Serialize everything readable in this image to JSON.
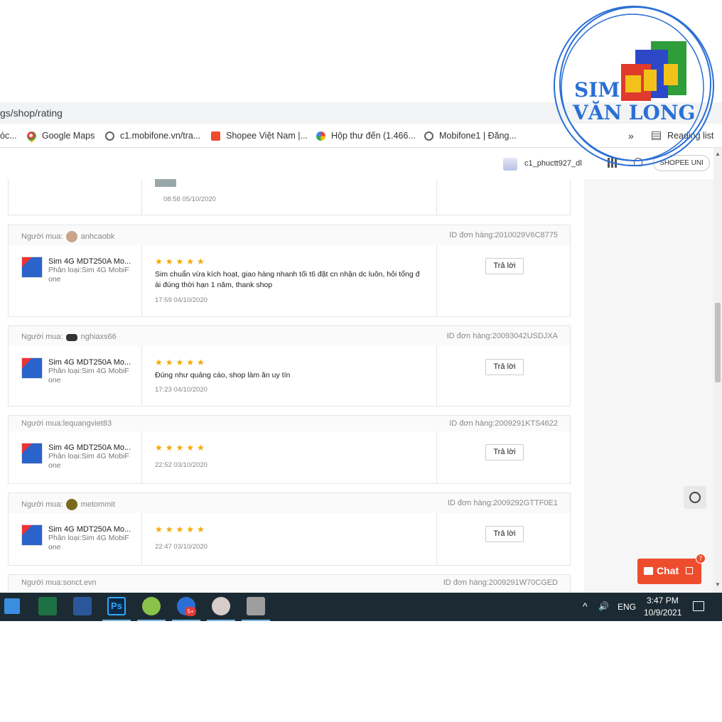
{
  "browser": {
    "url": "gs/shop/rating",
    "bookmarks": [
      {
        "label": "óc...",
        "icon": "bookmark-icon"
      },
      {
        "label": "Google Maps",
        "icon": "maps-pin-icon"
      },
      {
        "label": "c1.mobifone.vn/tra...",
        "icon": "globe-icon"
      },
      {
        "label": "Shopee Việt Nam |...",
        "icon": "shopee-bag-icon"
      },
      {
        "label": "Hộp thư đến (1.466...",
        "icon": "google-g-icon"
      },
      {
        "label": "Mobifone1 | Đăng...",
        "icon": "globe-icon"
      }
    ],
    "more": "»",
    "reading_list": "Reading list"
  },
  "header": {
    "username": "c1_phuctt927_dl",
    "shopee_uni": "SHOPEE UNI"
  },
  "watermark": {
    "line1": "SIM",
    "line2": "VĂN LONG"
  },
  "top_partial": {
    "time": "08:58 05/10/2020"
  },
  "reviews": [
    {
      "buyer_label": "Người mua:",
      "buyer": "anhcaobk",
      "order_id": "ID đơn hàng:2010029V6C8775",
      "product": "Sim 4G MDT250A Mo...",
      "variant": "Phân loại:Sim 4G MobiF one",
      "stars": "★★★★★",
      "rating": 5,
      "comment": "Sim chuẩn vừa kích hoạt, giao hàng nhanh tối t6 đặt cn nhận dc luôn, hỏi tổng đ ài đúng thời hạn 1 năm, thank shop",
      "time": "17:59 04/10/2020",
      "reply": "Trả lời"
    },
    {
      "buyer_label": "Người mua:",
      "buyer": "nghiaxs66",
      "order_id": "ID đơn hàng:20093042USDJXA",
      "product": "Sim 4G MDT250A Mo...",
      "variant": "Phân loại:Sim 4G MobiF one",
      "stars": "★★★★★",
      "rating": 5,
      "comment": "Đúng như quảng cáo, shop làm ăn uy tín",
      "time": "17:23 04/10/2020",
      "reply": "Trả lời"
    },
    {
      "buyer_label": "Người mua:",
      "buyer": "lequangviet83",
      "order_id": "ID đơn hàng:2009291KTS4622",
      "product": "Sim 4G MDT250A Mo...",
      "variant": "Phân loại:Sim 4G MobiF one",
      "stars": "★★★★★",
      "rating": 5,
      "comment": "",
      "time": "22:52 03/10/2020",
      "reply": "Trả lời"
    },
    {
      "buyer_label": "Người mua:",
      "buyer": "metommit",
      "order_id": "ID đơn hàng:2009292GTTF0E1",
      "product": "Sim 4G MDT250A Mo...",
      "variant": "Phân loại:Sim 4G MobiF one",
      "stars": "★★★★★",
      "rating": 5,
      "comment": "",
      "time": "22:47 03/10/2020",
      "reply": "Trả lời"
    },
    {
      "buyer_label": "Người mua:",
      "buyer": "sonct.evn",
      "order_id": "ID đơn hàng:2009291W70CGED"
    }
  ],
  "chat": {
    "label": "Chat",
    "badge": "7"
  },
  "taskbar": {
    "lang": "ENG",
    "time": "3:47 PM",
    "date": "10/9/2021",
    "zalo_badge": "5+",
    "ps_label": "Ps"
  },
  "colors": {
    "accent": "#ee4d2d",
    "star": "#f6a700",
    "watermark": "#2a6fd6"
  }
}
